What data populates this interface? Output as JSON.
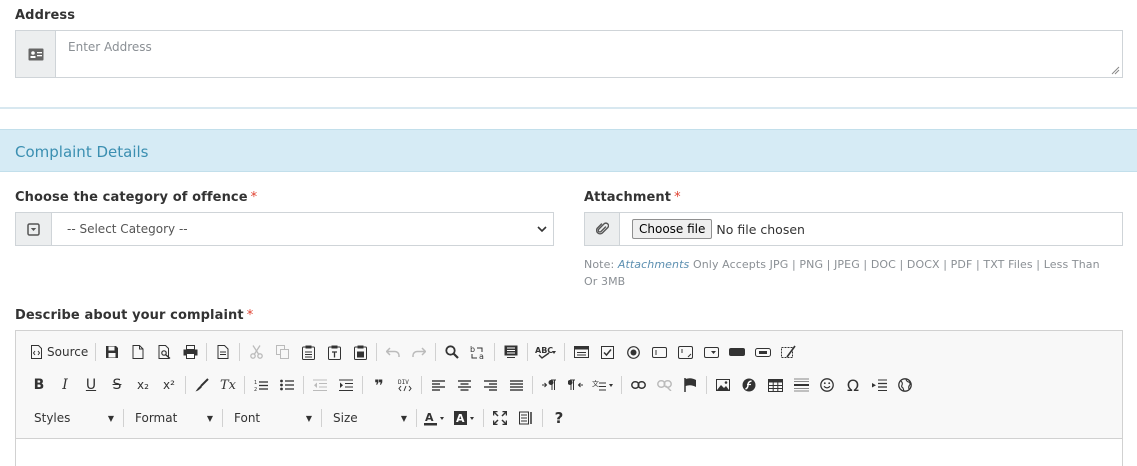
{
  "address": {
    "label": "Address",
    "placeholder": "Enter Address",
    "icon": "address-card-icon"
  },
  "complaint_section": {
    "title": "Complaint Details"
  },
  "category": {
    "label": "Choose the category of offence",
    "required_mark": "*",
    "selected": "-- Select Category --",
    "icon": "dropdown-box-icon"
  },
  "attachment": {
    "label": "Attachment",
    "required_mark": "*",
    "button_label": "Choose file",
    "status": "No file chosen",
    "icon": "paperclip-icon",
    "note_prefix": "Note:",
    "note_em": "Attachments",
    "note_text": " Only Accepts JPG | PNG | JPEG | DOC | DOCX | PDF | TXT Files | Less Than Or 3MB"
  },
  "description": {
    "label": "Describe about your complaint",
    "required_mark": "*"
  },
  "editor": {
    "source_label": "Source",
    "styles_label": "Styles",
    "format_label": "Format",
    "font_label": "Font",
    "size_label": "Size",
    "help_label": "?",
    "bold_label": "B",
    "italic_label": "I",
    "underline_label": "U",
    "strike_label": "S",
    "subscript_label": "x₂",
    "superscript_label": "x²",
    "removeformat_label": "Tx",
    "blockquote_label": "❞",
    "omega_label": "Ω"
  }
}
